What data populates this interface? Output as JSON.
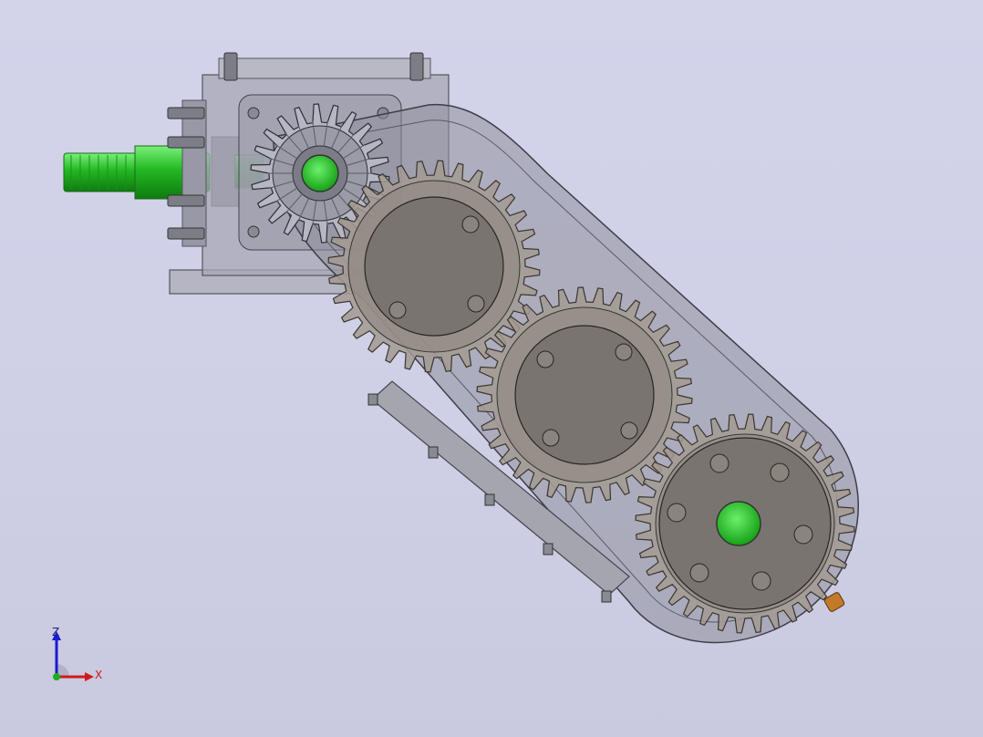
{
  "viewport": {
    "background_top": "#d3d3ea",
    "background_bottom": "#c9c9df"
  },
  "model": {
    "parts": [
      {
        "name": "input-shaft",
        "color": "#2fc62f"
      },
      {
        "name": "bevel-gearbox-housing",
        "color": "#9a9aa6"
      },
      {
        "name": "bevel-gear",
        "color": "#b9b9c2"
      },
      {
        "name": "drive-arm-cover",
        "color": "#8f8f99"
      },
      {
        "name": "spur-gear",
        "count": 3,
        "teeth_color": "#a09890"
      },
      {
        "name": "output-hub",
        "color": "#2fd22f"
      },
      {
        "name": "drain-plug",
        "color": "#c07a2a"
      }
    ]
  },
  "triad": {
    "z_label": "Z",
    "x_label": "X",
    "z_color": "#1a1ad0",
    "x_color": "#d01a1a",
    "y_color": "#1ab01a"
  }
}
